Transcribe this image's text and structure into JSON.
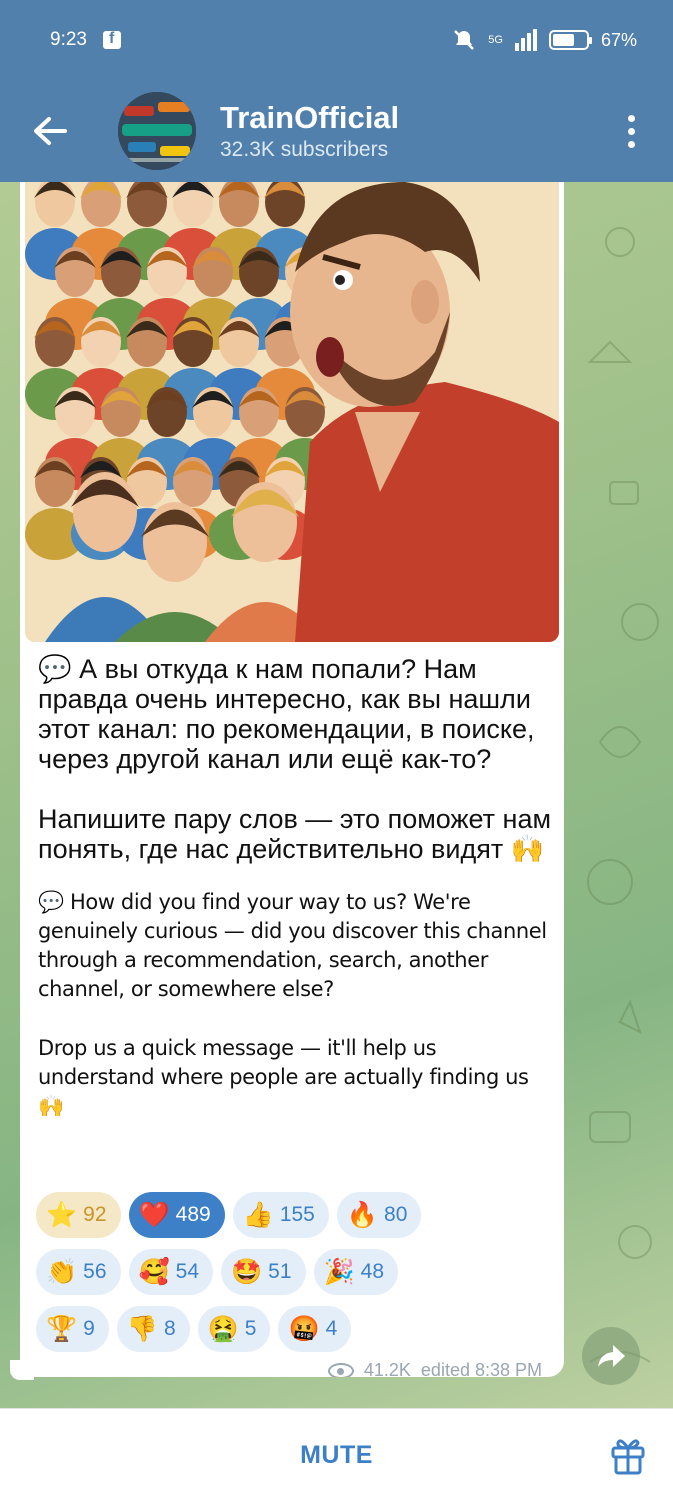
{
  "status": {
    "time": "9:23",
    "battery": "67%",
    "battery_level": 0.67,
    "network": "5G"
  },
  "header": {
    "back_icon": "arrow-left-icon",
    "channel_name": "TrainOfficial",
    "subscribers": "32.3K subscribers"
  },
  "post": {
    "ru_p1": "💬 А вы откуда к нам попали? Нам правда очень интересно, как вы нашли этот канал: по рекомендации, в поиске, через другой канал или ещё как-то?",
    "ru_p2": "Напишите пару слов — это поможет нам понять, где нас действительно видят 🙌",
    "en_p1": "💬 How did you find your way to us? We're genuinely curious — did you discover this channel through a recommendation, search, another channel, or somewhere else?",
    "en_p2": "Drop us a quick message — it'll help us understand where people are actually finding us 🙌",
    "views": "41.2K",
    "edited": "edited 8:38 PM"
  },
  "reactions": [
    {
      "emoji": "⭐",
      "count": "92"
    },
    {
      "emoji": "❤️",
      "count": "489"
    },
    {
      "emoji": "👍",
      "count": "155"
    },
    {
      "emoji": "🔥",
      "count": "80"
    },
    {
      "emoji": "👏",
      "count": "56"
    },
    {
      "emoji": "🥰",
      "count": "54"
    },
    {
      "emoji": "🤩",
      "count": "51"
    },
    {
      "emoji": "🎉",
      "count": "48"
    },
    {
      "emoji": "🏆",
      "count": "9"
    },
    {
      "emoji": "👎",
      "count": "8"
    },
    {
      "emoji": "🤮",
      "count": "5"
    },
    {
      "emoji": "🤬",
      "count": "4"
    }
  ],
  "bottom": {
    "mute_label": "MUTE"
  },
  "colors": {
    "header": "#5280ad",
    "accent": "#3d80c7"
  }
}
